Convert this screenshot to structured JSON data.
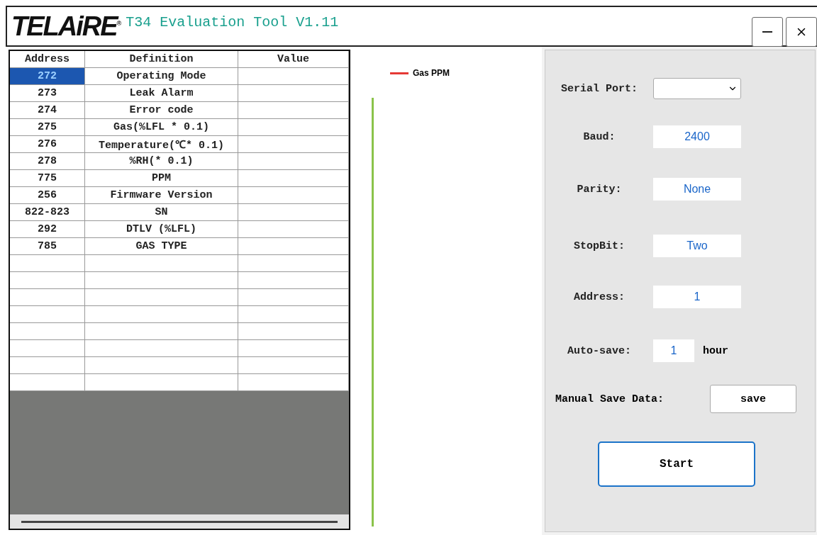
{
  "window": {
    "logo": "TELAiRE$^{®}$",
    "title": "T34 Evaluation Tool V1.11"
  },
  "table": {
    "columns": [
      "Address",
      "Definition",
      "Value"
    ],
    "rows": [
      {
        "address": "272",
        "definition": "Operating Mode",
        "selected": true
      },
      {
        "address": "273",
        "definition": "Leak Alarm",
        "selected": false
      },
      {
        "address": "274",
        "definition": "Error code",
        "selected": false
      },
      {
        "address": "275",
        "definition": "Gas(%LFL * 0.1)",
        "selected": false
      },
      {
        "address": "276",
        "definition": "Temperature(℃* 0.1)",
        "selected": false
      },
      {
        "address": "278",
        "definition": "%RH(* 0.1)",
        "selected": false
      },
      {
        "address": "775",
        "definition": "PPM",
        "selected": false
      },
      {
        "address": "256",
        "definition": "Firmware Version",
        "selected": false
      },
      {
        "address": "822-823",
        "definition": "SN",
        "selected": false
      },
      {
        "address": "292",
        "definition": "DTLV (%LFL)",
        "selected": false
      },
      {
        "address": "785",
        "definition": "GAS TYPE",
        "selected": false
      }
    ]
  },
  "chart": {
    "legend": "Gas PPM"
  },
  "settings": [
    {
      "kind": "dropdown",
      "label": "Serial Port:"
    },
    {
      "kind": "field",
      "label": "Baud:",
      "value": "2400"
    },
    {
      "kind": "field",
      "label": "Parity:",
      "value": "None"
    },
    {
      "kind": "field",
      "label": "StopBit:",
      "value": "Two"
    },
    {
      "kind": "field",
      "label": "Address:",
      "value": "1"
    },
    {
      "kind": "short",
      "label": "Auto-save:",
      "value": "1",
      "unit": "hour"
    }
  ],
  "manual_save": {
    "label": "Manual Save Data:",
    "button": "save"
  },
  "start_button": "Start"
}
